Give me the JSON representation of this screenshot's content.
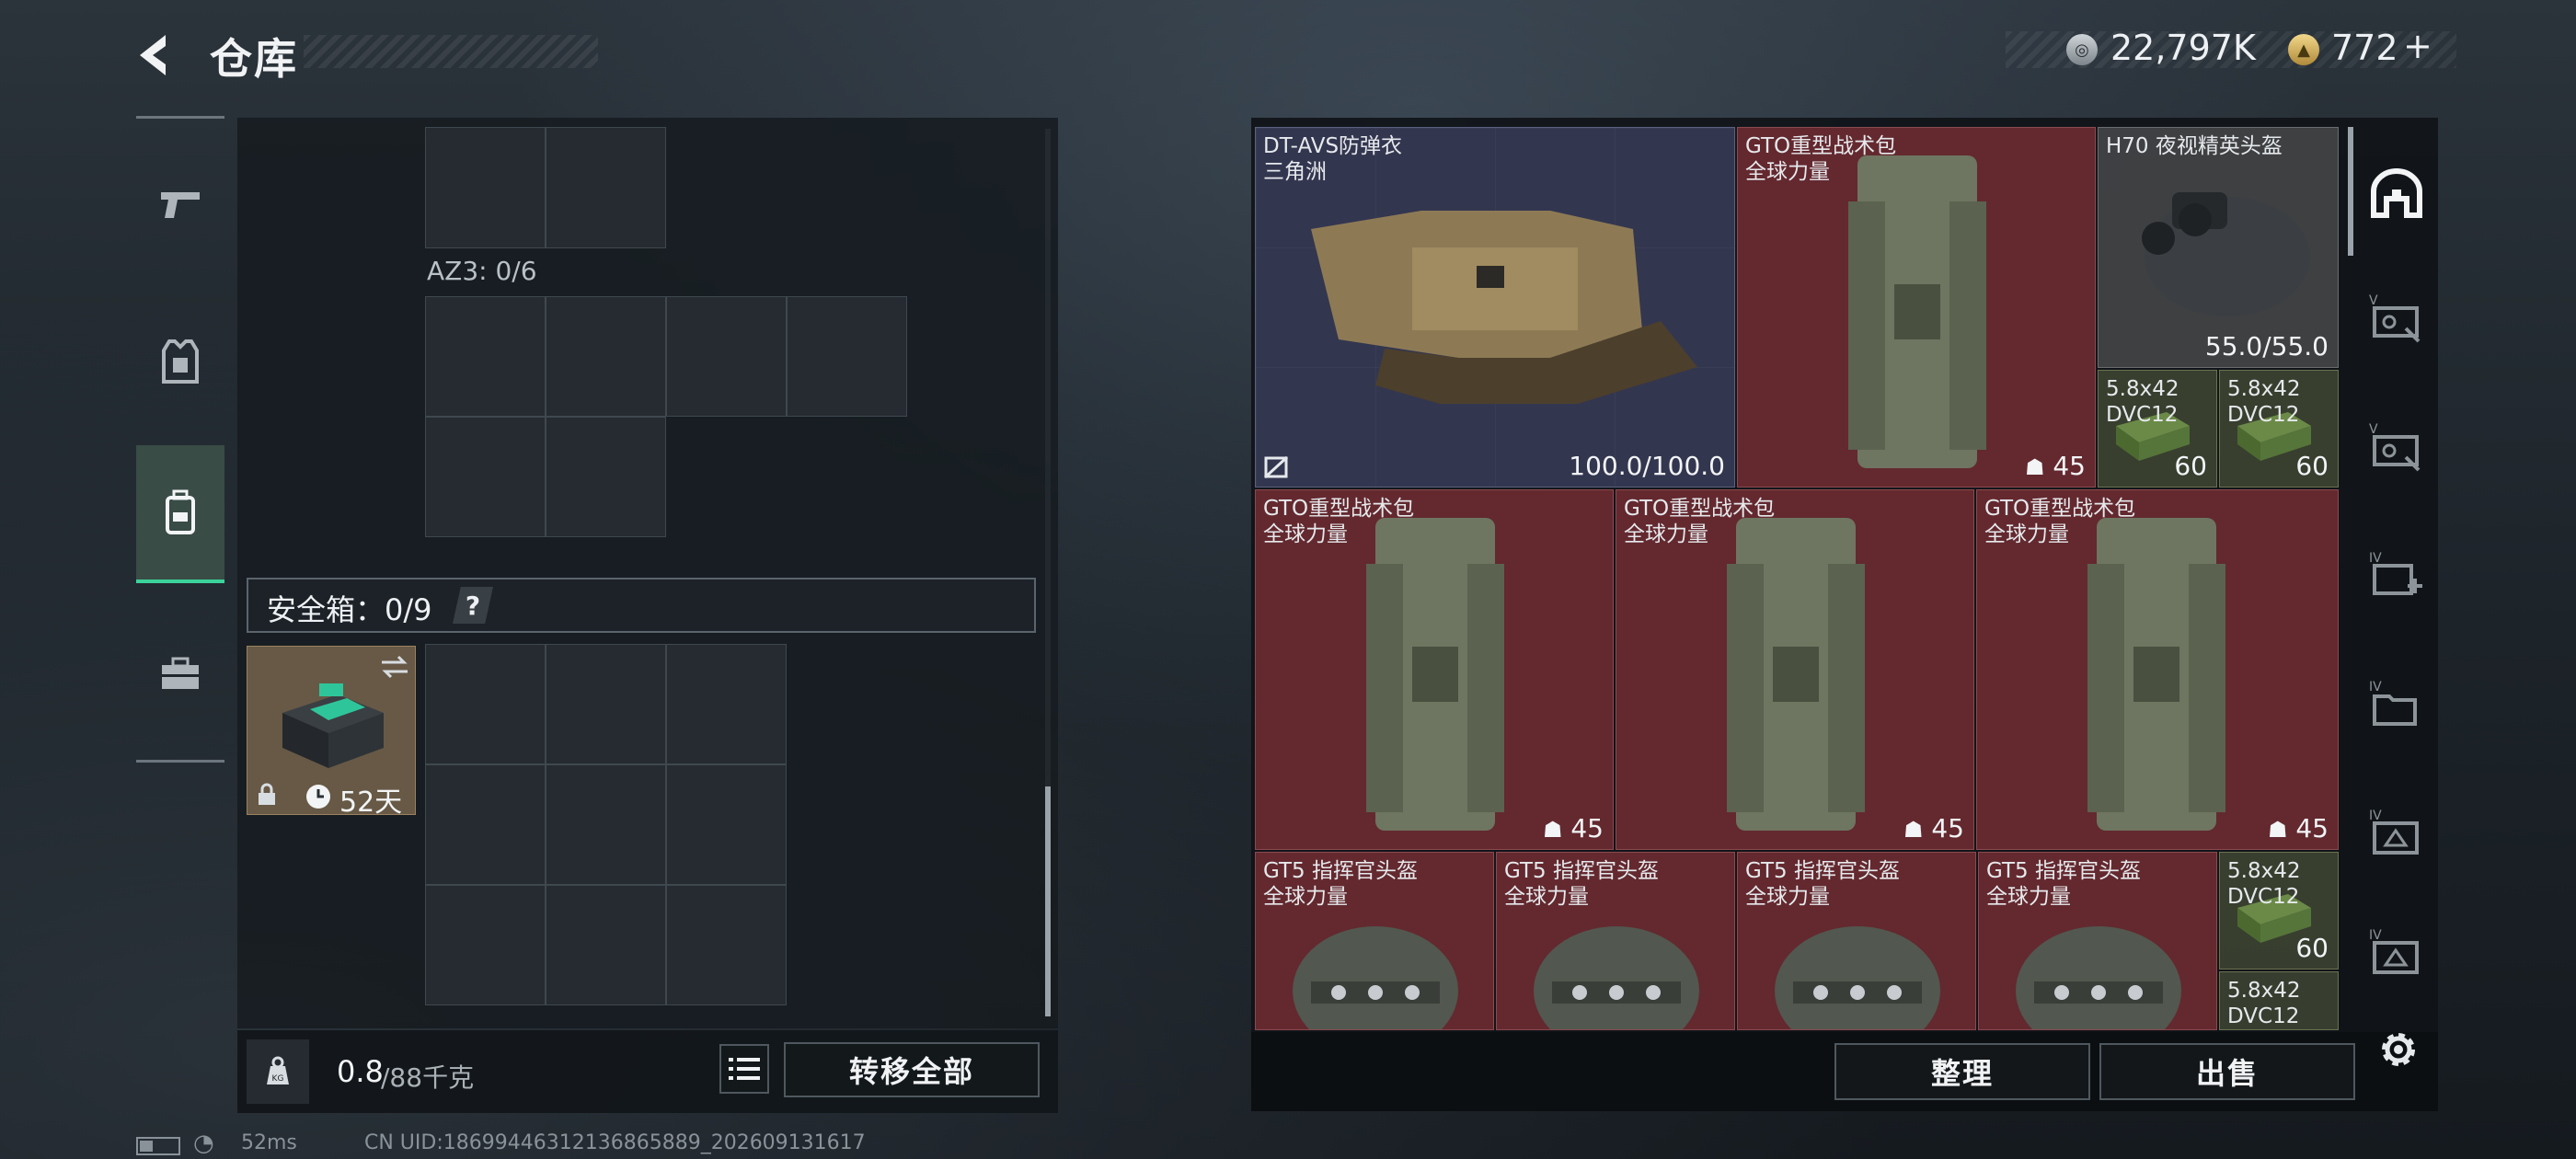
{
  "header": {
    "title": "仓库"
  },
  "currency": {
    "silver": "22,797K",
    "gold": "772",
    "gold_plus": "+"
  },
  "left_tabs": [
    {
      "name": "weapons",
      "icon": "pistol-icon"
    },
    {
      "name": "armor",
      "icon": "armor-icon"
    },
    {
      "name": "backpack",
      "icon": "backpack-icon",
      "active": true
    },
    {
      "name": "toolbox",
      "icon": "toolbox-icon"
    }
  ],
  "containers": {
    "az3_label": "AZ3: 0/6",
    "safe_box_label": "安全箱：0/9",
    "help": "?",
    "safe_box_days": "52天"
  },
  "weight": {
    "current": "0.8",
    "max_unit": "/88千克"
  },
  "buttons": {
    "transfer_all": "转移全部",
    "sort": "整理",
    "sell": "出售"
  },
  "items": [
    {
      "name": "DT-AVS防弹衣\n三角洲",
      "value": "100.0/100.0",
      "color": "blue"
    },
    {
      "name": "GTO重型战术包\n全球力量",
      "value": "45",
      "color": "red"
    },
    {
      "name": "H70 夜视精英头盔",
      "value": "55.0/55.0",
      "color": "gray"
    },
    {
      "name": "5.8x42\nDVC12",
      "value": "60",
      "color": "green"
    },
    {
      "name": "5.8x42\nDVC12",
      "value": "60",
      "color": "green"
    },
    {
      "name": "GTO重型战术包\n全球力量",
      "value": "45",
      "color": "red"
    },
    {
      "name": "GTO重型战术包\n全球力量",
      "value": "45",
      "color": "red"
    },
    {
      "name": "GTO重型战术包\n全球力量",
      "value": "45",
      "color": "red"
    },
    {
      "name": "GT5 指挥官头盔\n全球力量",
      "value": "",
      "color": "red"
    },
    {
      "name": "GT5 指挥官头盔\n全球力量",
      "value": "",
      "color": "red"
    },
    {
      "name": "GT5 指挥官头盔\n全球力量",
      "value": "",
      "color": "red"
    },
    {
      "name": "GT5 指挥官头盔\n全球力量",
      "value": "",
      "color": "red"
    },
    {
      "name": "5.8x42\nDVC12",
      "value": "60",
      "color": "green"
    },
    {
      "name": "5.8x42\nDVC12",
      "value": "",
      "color": "green"
    }
  ],
  "right_tabs": [
    "helmet-slot-icon",
    "case-v-icon",
    "case-v2-icon",
    "add-iv-icon",
    "folder-iv-icon",
    "case-iv-icon",
    "case-iv2-icon"
  ],
  "status": {
    "ping": "52ms",
    "uid": "CN UID:18699446312136865889_202609131617"
  },
  "colors": {
    "accent_green": "#3bd39b",
    "item_red": "#6e2c32",
    "item_blue": "#363a54"
  }
}
